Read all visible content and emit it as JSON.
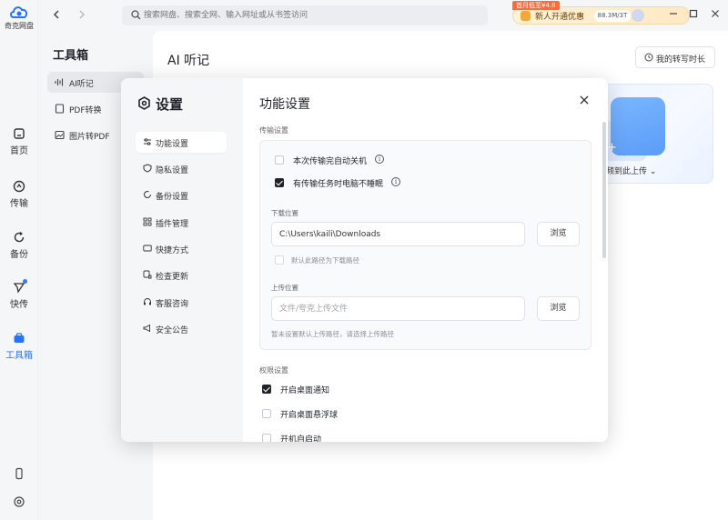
{
  "app": {
    "logo_text": "奇克网盘"
  },
  "rail": {
    "items": [
      {
        "label": "首页"
      },
      {
        "label": "传输"
      },
      {
        "label": "备份"
      },
      {
        "label": "快传"
      },
      {
        "label": "工具箱"
      }
    ]
  },
  "topbar": {
    "search_placeholder": "搜索网盘、搜索全网、输入网址或从书签访问",
    "vip_tag": "首月低至¥4.8",
    "vip_label": "新人开通优惠",
    "quota": "88.3M/3T"
  },
  "tools": {
    "title": "工具箱",
    "items": [
      {
        "label": "AI听记"
      },
      {
        "label": "PDF转换"
      },
      {
        "label": "图片转PDF"
      }
    ]
  },
  "main": {
    "title": "AI 听记",
    "my_records": "我的转写时长",
    "upload_text": "频到此上传"
  },
  "settings": {
    "title": "设置",
    "nav": [
      {
        "label": "功能设置"
      },
      {
        "label": "隐私设置"
      },
      {
        "label": "备份设置"
      },
      {
        "label": "插件管理"
      },
      {
        "label": "快捷方式"
      },
      {
        "label": "检查更新"
      },
      {
        "label": "客服咨询"
      },
      {
        "label": "安全公告"
      }
    ],
    "page_title": "功能设置",
    "transfer_section": "传输设置",
    "shutdown_after": "本次传输完自动关机",
    "no_sleep": "有传输任务时电脑不睡眠",
    "download_label": "下载位置",
    "download_path": "C:\\Users\\kaili\\Downloads",
    "browse": "浏览",
    "default_download": "默认此路径为下载路径",
    "upload_label": "上传位置",
    "upload_placeholder": "文件/夸克上传文件",
    "upload_hint": "暂未设置默认上传路径，请选择上传路径",
    "permission_section": "权限设置",
    "desktop_notify": "开启桌面通知",
    "desktop_float": "开启桌面悬浮球",
    "auto_start": "开机自启动"
  }
}
